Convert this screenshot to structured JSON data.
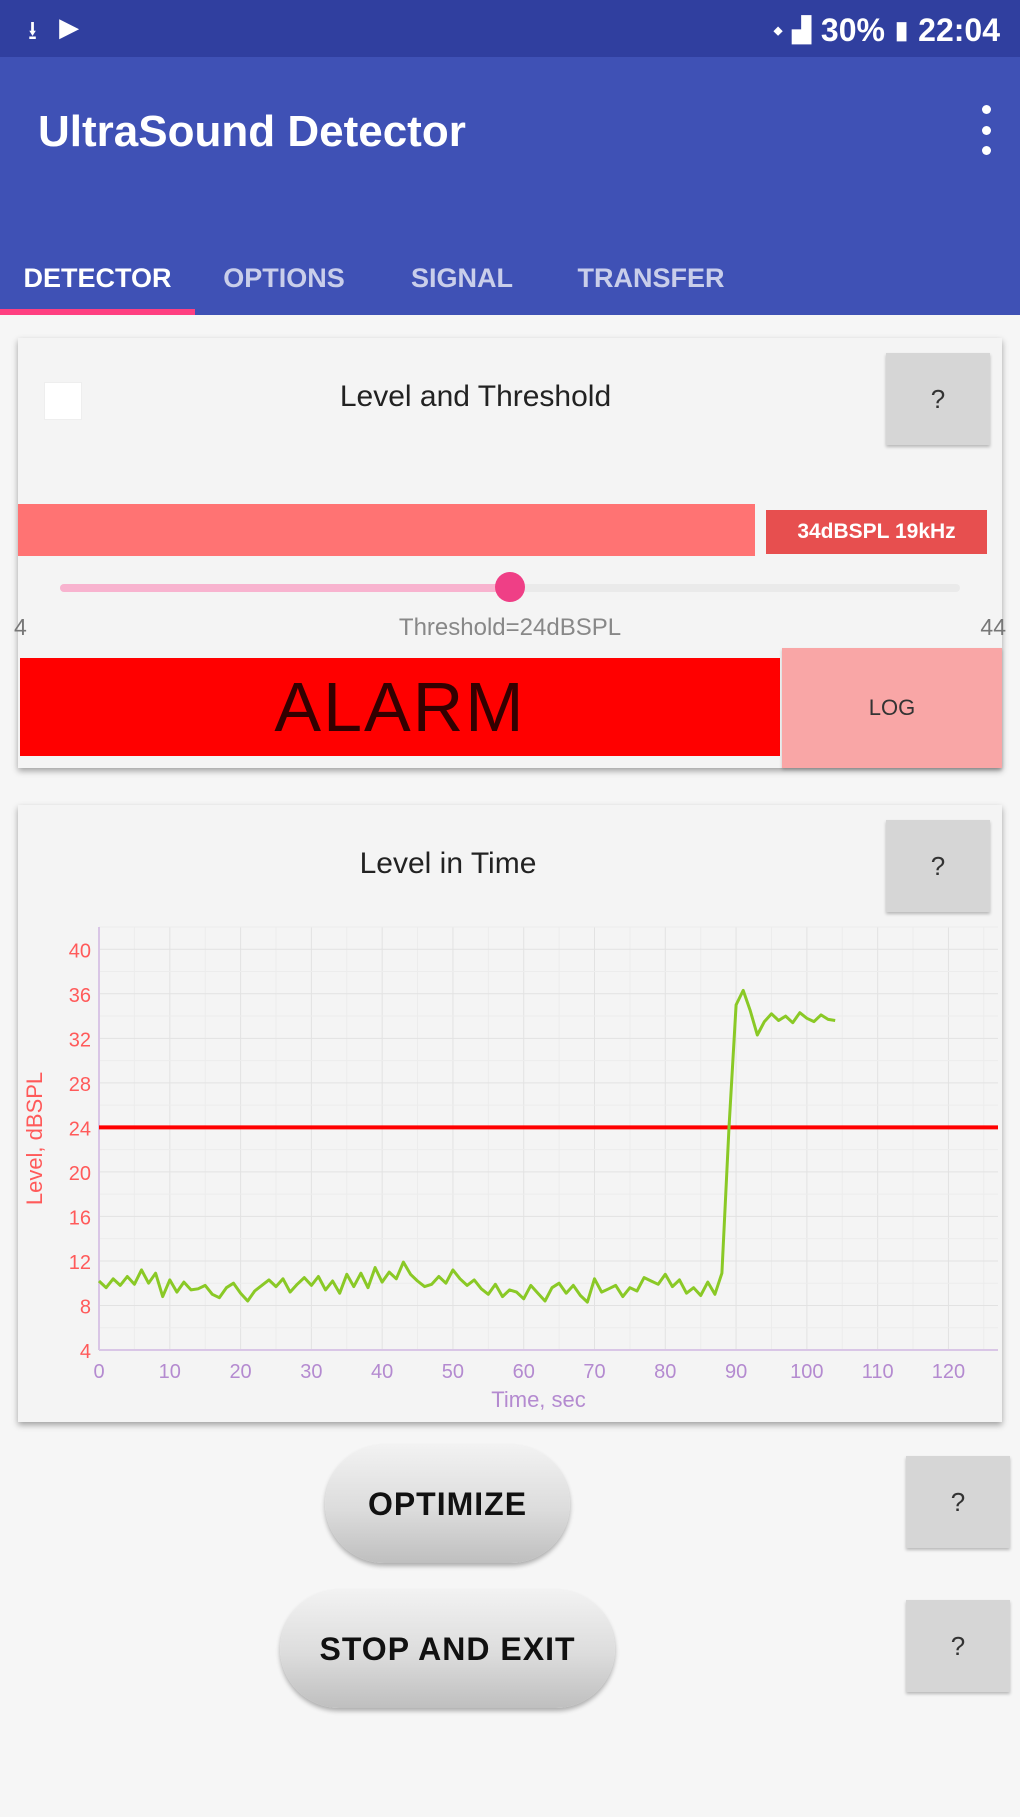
{
  "status_bar": {
    "battery": "30%",
    "time": "22:04"
  },
  "app_bar": {
    "title": "UltraSound Detector"
  },
  "tabs": [
    {
      "label": "DETECTOR",
      "active": true
    },
    {
      "label": "OPTIONS",
      "active": false
    },
    {
      "label": "SIGNAL",
      "active": false
    },
    {
      "label": "TRANSFER",
      "active": false
    }
  ],
  "level_card": {
    "title": "Level and Threshold",
    "help_label": "?",
    "enabled_checked": false,
    "level_readout": "34dBSPL 19kHz",
    "slider_min_label": "4",
    "slider_max_label": "44",
    "threshold_label": "Threshold=24dBSPL",
    "threshold_slider_fraction": 0.5,
    "level_bar_fraction": 0.75,
    "alarm_label": "ALARM",
    "log_label": "LOG"
  },
  "time_card": {
    "title": "Level in Time",
    "help_label": "?"
  },
  "chart_data": {
    "type": "line",
    "xlabel": "Time, sec",
    "ylabel": "Level, dBSPL",
    "xlim": [
      0,
      127
    ],
    "ylim": [
      4,
      42
    ],
    "x_ticks": [
      0,
      10,
      20,
      30,
      40,
      50,
      60,
      70,
      80,
      90,
      100,
      110,
      120
    ],
    "y_ticks": [
      4,
      8,
      12,
      16,
      20,
      24,
      28,
      32,
      36,
      40
    ],
    "grid": true,
    "threshold": 24,
    "colors": {
      "series": "#8ac926",
      "threshold": "#ff0000",
      "ylabel": "#ff5a5a",
      "xlabel": "#b48ad0"
    },
    "series": [
      {
        "x": [
          0,
          1,
          2,
          3,
          4,
          5,
          6,
          7,
          8,
          9,
          10,
          11,
          12,
          13,
          14,
          15,
          16,
          17,
          18,
          19,
          20,
          21,
          22,
          23,
          24,
          25,
          26,
          27,
          28,
          29,
          30,
          31,
          32,
          33,
          34,
          35,
          36,
          37,
          38,
          39,
          40,
          41,
          42,
          43,
          44,
          45,
          46,
          47,
          48,
          49,
          50,
          51,
          52,
          53,
          54,
          55,
          56,
          57,
          58,
          59,
          60,
          61,
          62,
          63,
          64,
          65,
          66,
          67,
          68,
          69,
          70,
          71,
          72,
          73,
          74,
          75,
          76,
          77,
          78,
          79,
          80,
          81,
          82,
          83,
          84,
          85,
          86,
          87,
          88,
          89,
          90,
          91,
          92,
          93,
          94,
          95,
          96,
          97,
          98,
          99,
          100,
          101,
          102,
          103,
          104
        ],
        "y": [
          10.2,
          9.6,
          10.4,
          9.8,
          10.6,
          9.9,
          11.2,
          10.0,
          10.9,
          8.8,
          10.3,
          9.2,
          10.1,
          9.4,
          9.5,
          9.8,
          9.0,
          8.7,
          9.6,
          10.0,
          9.1,
          8.4,
          9.3,
          9.8,
          10.3,
          9.7,
          10.4,
          9.2,
          9.9,
          10.5,
          9.8,
          10.6,
          9.4,
          10.2,
          9.1,
          10.8,
          9.7,
          10.9,
          9.6,
          11.4,
          10.1,
          11.0,
          10.4,
          11.9,
          10.8,
          10.2,
          9.7,
          9.9,
          10.6,
          10.0,
          11.2,
          10.4,
          9.8,
          10.3,
          9.5,
          9.0,
          9.9,
          8.8,
          9.4,
          9.2,
          8.6,
          9.8,
          9.1,
          8.4,
          9.6,
          10.0,
          9.1,
          9.8,
          8.9,
          8.3,
          10.4,
          9.2,
          9.5,
          9.8,
          8.8,
          9.6,
          9.3,
          10.5,
          10.2,
          9.9,
          10.8,
          9.7,
          10.3,
          9.1,
          9.6,
          8.9,
          10.1,
          9.0,
          10.9,
          24.0,
          35.0,
          36.3,
          34.5,
          32.3,
          33.5,
          34.2,
          33.6,
          34.0,
          33.4,
          34.3,
          33.8,
          33.5,
          34.1,
          33.7,
          33.6
        ]
      }
    ]
  },
  "actions": {
    "optimize_label": "OPTIMIZE",
    "stop_label": "STOP AND EXIT",
    "help_label": "?"
  }
}
